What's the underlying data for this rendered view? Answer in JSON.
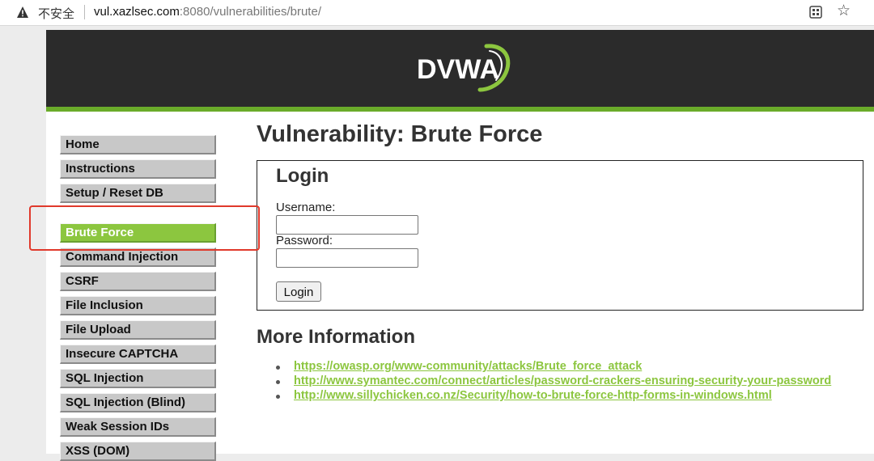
{
  "browser": {
    "insecure_label": "不安全",
    "url_host": "vul.xazlsec.com",
    "url_rest": ":8080/vulnerabilities/brute/"
  },
  "header": {
    "logo_text": "DVWA"
  },
  "menu": {
    "items": [
      {
        "label": "Home"
      },
      {
        "label": "Instructions"
      },
      {
        "label": "Setup / Reset DB"
      },
      {
        "label": "Brute Force",
        "active": true
      },
      {
        "label": "Command Injection"
      },
      {
        "label": "CSRF"
      },
      {
        "label": "File Inclusion"
      },
      {
        "label": "File Upload"
      },
      {
        "label": "Insecure CAPTCHA"
      },
      {
        "label": "SQL Injection"
      },
      {
        "label": "SQL Injection (Blind)"
      },
      {
        "label": "Weak Session IDs"
      },
      {
        "label": "XSS (DOM)"
      }
    ]
  },
  "main": {
    "title": "Vulnerability: Brute Force",
    "login": {
      "heading": "Login",
      "username_label": "Username:",
      "username_value": "",
      "password_label": "Password:",
      "password_value": "",
      "submit_label": "Login"
    },
    "more_info": {
      "heading": "More Information",
      "links": [
        "https://owasp.org/www-community/attacks/Brute_force_attack",
        "http://www.symantec.com/connect/articles/password-crackers-ensuring-security-your-password",
        "http://www.sillychicken.co.nz/Security/how-to-brute-force-http-forms-in-windows.html"
      ]
    }
  },
  "colors": {
    "accent": "#8cc63f",
    "header_bg": "#2b2b2b",
    "annotation": "#e0392b"
  }
}
